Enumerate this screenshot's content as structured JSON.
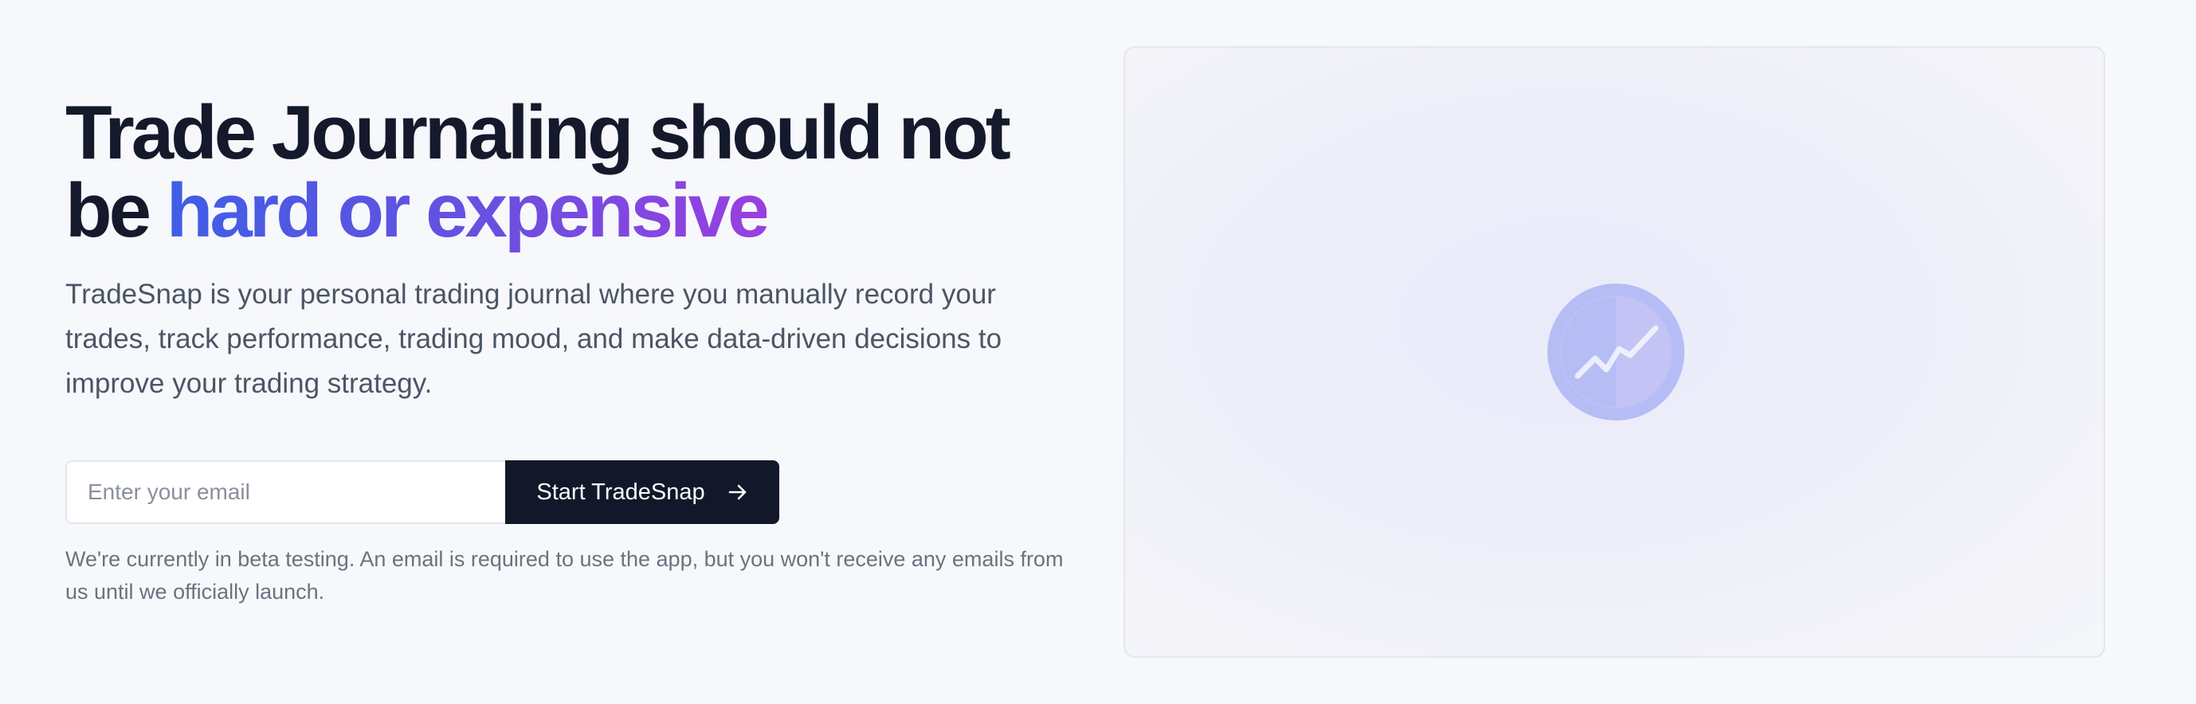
{
  "hero": {
    "headline_part1": "Trade Journaling should not be ",
    "headline_highlight": "hard or expensive",
    "subtitle": "TradeSnap is your personal trading journal where you manually record your trades, track performance, trading mood, and make data-driven decisions to improve your trading strategy."
  },
  "form": {
    "email_placeholder": "Enter your email",
    "email_value": "",
    "cta_label": "Start TradeSnap",
    "cta_icon": "arrow-right-icon"
  },
  "beta_note": "We're currently in beta testing. An email is required to use the app, but you won't receive any emails from us until we officially launch.",
  "preview": {
    "icon": "chart-trend-icon"
  },
  "colors": {
    "headline": "#141a2b",
    "gradient_start": "#3f5ee6",
    "gradient_end": "#9a3fe0",
    "cta_background": "#121829",
    "body_text": "#4b5565",
    "note_text": "#6b7280",
    "icon_circle": "#b6bdf5"
  }
}
